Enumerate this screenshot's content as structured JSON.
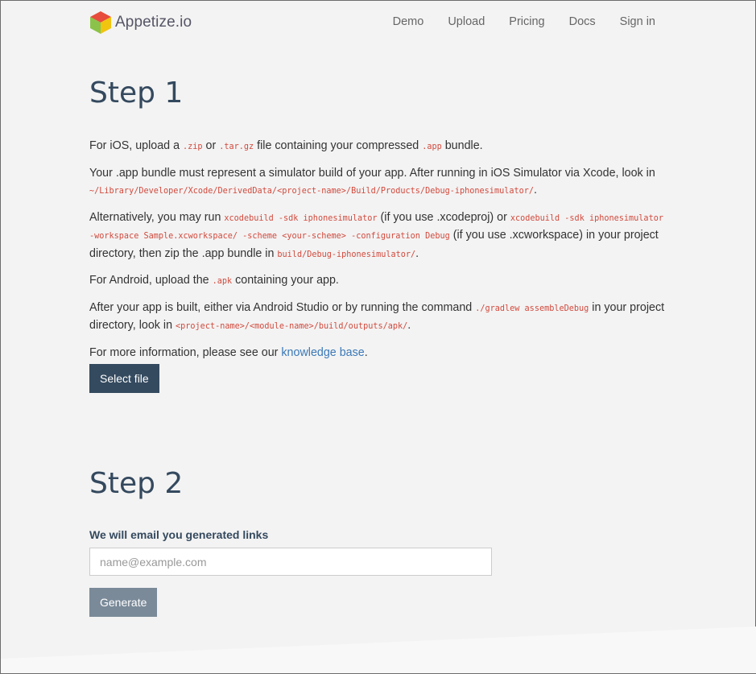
{
  "nav": {
    "brand": "Appetize.io",
    "links": [
      "Demo",
      "Upload",
      "Pricing",
      "Docs",
      "Sign in"
    ]
  },
  "step1": {
    "title": "Step 1",
    "p1": {
      "t1": "For iOS, upload a ",
      "c1": ".zip",
      "t2": " or ",
      "c2": ".tar.gz",
      "t3": " file containing your compressed ",
      "c3": ".app",
      "t4": " bundle."
    },
    "p2": {
      "t1": "Your .app bundle must represent a simulator build of your app. After running in iOS Simulator via Xcode, look in ",
      "c1": "~/Library/Developer/Xcode/DerivedData/<project-name>/Build/Products/Debug-iphonesimulator/",
      "t2": "."
    },
    "p3": {
      "t1": "Alternatively, you may run ",
      "c1": "xcodebuild -sdk iphonesimulator",
      "t2": " (if you use .xcodeproj) or ",
      "c2": "xcodebuild -sdk iphonesimulator -workspace Sample.xcworkspace/ -scheme <your-scheme> -configuration Debug",
      "t3": " (if you use .xcworkspace) in your project directory, then zip the .app bundle in ",
      "c3": "build/Debug-iphonesimulator/",
      "t4": "."
    },
    "p4": {
      "t1": "For Android, upload the ",
      "c1": ".apk",
      "t2": " containing your app."
    },
    "p5": {
      "t1": "After your app is built, either via Android Studio or by running the command ",
      "c1": "./gradlew assembleDebug",
      "t2": " in your project directory, look in ",
      "c2": "<project-name>/<module-name>/build/outputs/apk/",
      "t3": "."
    },
    "p6": {
      "t1": "For more information, please see our ",
      "link": "knowledge base",
      "t2": "."
    },
    "select_button": "Select file"
  },
  "step2": {
    "title": "Step 2",
    "label": "We will email you generated links",
    "email_placeholder": "name@example.com",
    "generate_button": "Generate"
  }
}
